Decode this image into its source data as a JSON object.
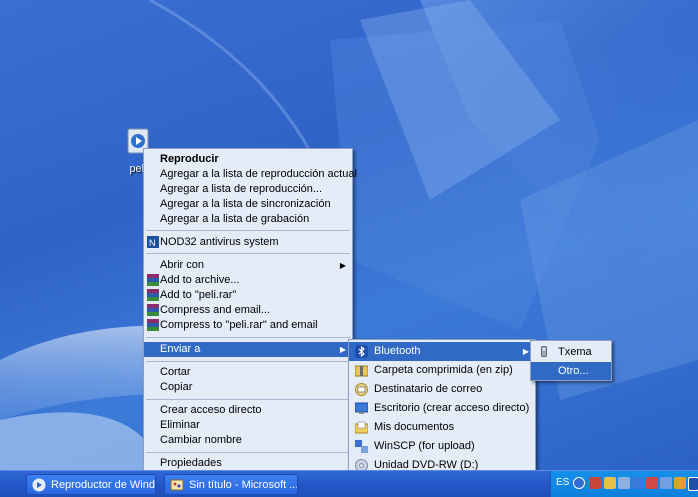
{
  "desktop": {
    "icon_label": "peli"
  },
  "context_menu": {
    "items": [
      {
        "label": "Reproducir",
        "bold": true
      },
      {
        "label": "Agregar a la lista de reproducción actual"
      },
      {
        "label": "Agregar a lista de reproducción..."
      },
      {
        "label": "Agregar a la lista de sincronización"
      },
      {
        "label": "Agregar a la lista de grabación"
      },
      {
        "label": "NOD32 antivirus system"
      },
      {
        "label": "Abrir con"
      },
      {
        "label": "Add to archive..."
      },
      {
        "label": "Add to \"peli.rar\""
      },
      {
        "label": "Compress and email..."
      },
      {
        "label": "Compress to \"peli.rar\" and email"
      },
      {
        "label": "Enviar a"
      },
      {
        "label": "Cortar"
      },
      {
        "label": "Copiar"
      },
      {
        "label": "Crear acceso directo"
      },
      {
        "label": "Eliminar"
      },
      {
        "label": "Cambiar nombre"
      },
      {
        "label": "Propiedades"
      }
    ]
  },
  "sendto_menu": {
    "items": [
      {
        "label": "Bluetooth"
      },
      {
        "label": "Carpeta comprimida (en zip)"
      },
      {
        "label": "Destinatario de correo"
      },
      {
        "label": "Escritorio (crear acceso directo)"
      },
      {
        "label": "Mis documentos"
      },
      {
        "label": "WinSCP (for upload)"
      },
      {
        "label": "Unidad DVD-RW (D:)"
      }
    ]
  },
  "bluetooth_menu": {
    "items": [
      {
        "label": "Txema"
      },
      {
        "label": "Otro..."
      }
    ]
  },
  "taskbar": {
    "buttons": [
      {
        "label": "Reproductor de Wind..."
      },
      {
        "label": "Sin título - Microsoft ..."
      }
    ],
    "tray": {
      "language": "ES"
    }
  },
  "colors": {
    "menu_bg": "#e4ecf7",
    "highlight": "#316ac5",
    "taskbar": "#2457c8",
    "tray": "#0f86e0"
  }
}
